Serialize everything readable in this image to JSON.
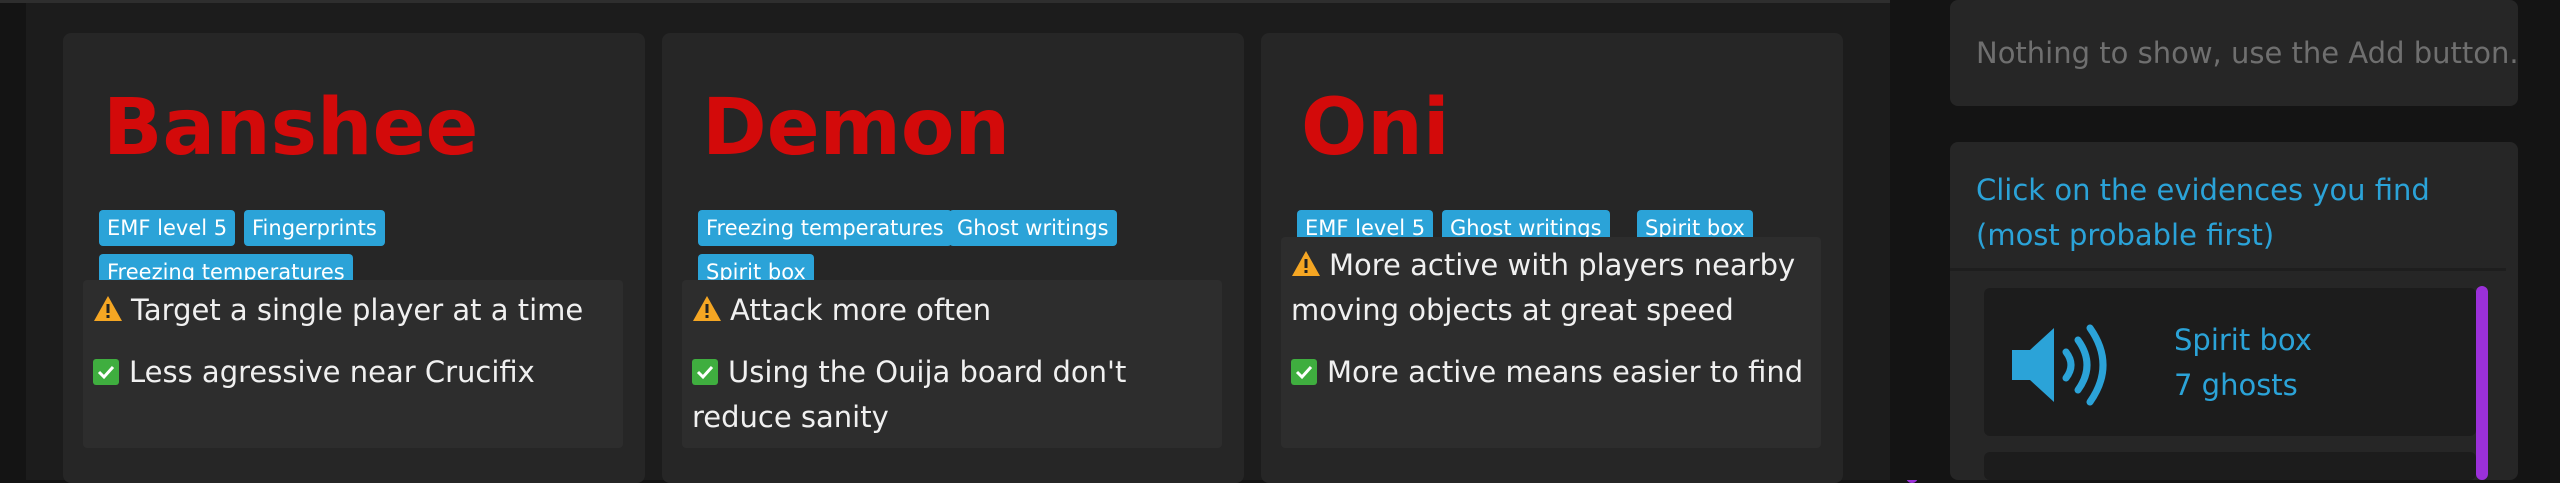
{
  "ghosts": [
    {
      "name": "Banshee",
      "evidences": [
        "EMF level 5",
        "Fingerprints",
        "Freezing temperatures"
      ],
      "warning": "Target a single player at a time",
      "strength": "Less agressive near Crucifix"
    },
    {
      "name": "Demon",
      "evidences": [
        "Freezing temperatures",
        "Ghost writings",
        "Spirit box"
      ],
      "warning": "Attack more often",
      "strength": "Using the Ouija board don't reduce sanity"
    },
    {
      "name": "Oni",
      "evidences": [
        "EMF level 5",
        "Ghost writings",
        "Spirit box"
      ],
      "warning": "More active with players nearby moving objects at great speed",
      "strength": "More active means easier to find"
    }
  ],
  "found_evidences": {
    "empty_text": "Nothing to show, use the Add button."
  },
  "evidence_picker": {
    "instructions": "Click on the evidences you find (most probable first)",
    "items": [
      {
        "name": "Spirit box",
        "count": "7 ghosts",
        "icon": "speaker-icon"
      }
    ]
  },
  "colors": {
    "ghost_name": "#d30a0a",
    "badge": "#2ba3d8",
    "accent_text": "#2ba3d8",
    "scrollbar": "#9b30d9",
    "warning": "#f5a623",
    "check": "#3fae3f"
  }
}
